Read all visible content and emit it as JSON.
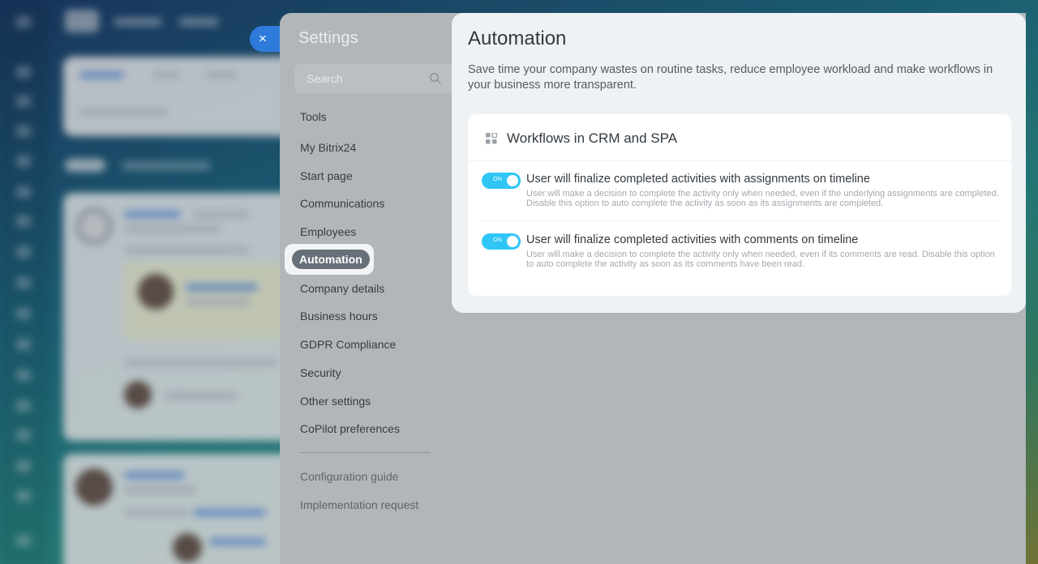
{
  "settings": {
    "title": "Settings",
    "search_placeholder": "Search",
    "menu": [
      {
        "label": "Tools"
      },
      {
        "label": "My Bitrix24"
      },
      {
        "label": "Start page"
      },
      {
        "label": "Communications"
      },
      {
        "label": "Employees"
      },
      {
        "label": "Automation",
        "active": true
      },
      {
        "label": "Company details"
      },
      {
        "label": "Business hours"
      },
      {
        "label": "GDPR Compliance"
      },
      {
        "label": "Security"
      },
      {
        "label": "Other settings"
      },
      {
        "label": "CoPilot preferences"
      }
    ],
    "secondary_menu": [
      {
        "label": "Configuration guide"
      },
      {
        "label": "Implementation request"
      }
    ]
  },
  "close_button": {
    "icon": "close-icon",
    "glyph": "×"
  },
  "automation": {
    "title": "Automation",
    "description": "Save time your company wastes on routine tasks, reduce employee workload and make workflows in your business more transparent.",
    "card": {
      "icon": "grid-icon",
      "title": "Workflows in CRM and SPA",
      "options": [
        {
          "toggle_label": "ON",
          "enabled": true,
          "title": "User will finalize completed activities with assignments on timeline",
          "description": "User will make a decision to complete the activity only when needed, even if the underlying assignments are completed. Disable this option to auto complete the activity as soon as its assignments are completed."
        },
        {
          "toggle_label": "ON",
          "enabled": true,
          "title": "User will finalize completed activities with comments on timeline",
          "description": "User will make a decision to complete the activity only when needed, even if its comments are read. Disable this option to auto complete the activity as soon as its comments have been read."
        }
      ]
    }
  },
  "colors": {
    "accent": "#2fc6f6",
    "close_button": "#2f7bdc",
    "active_menu": "#676f78"
  }
}
